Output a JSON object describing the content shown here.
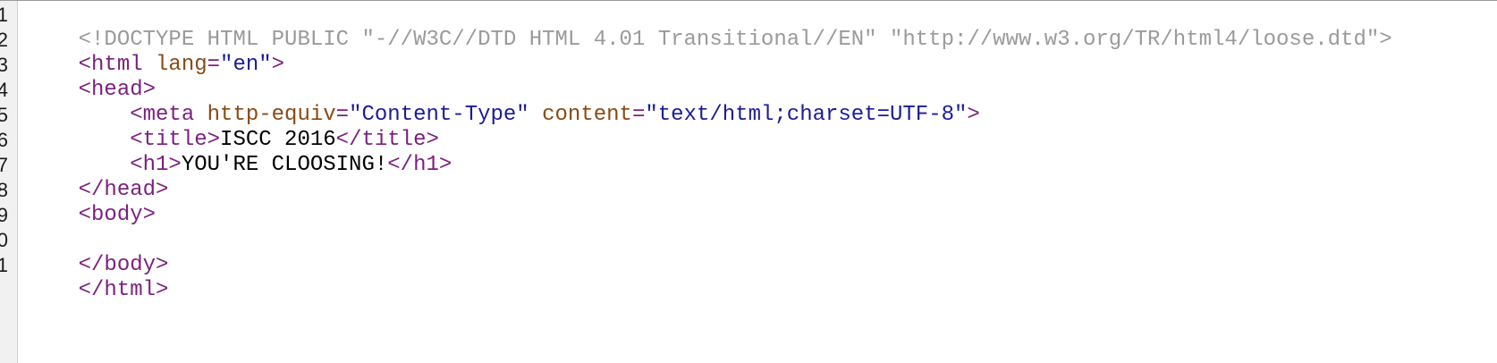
{
  "editor": {
    "line_numbers": [
      "1",
      "2",
      "3",
      "4",
      "5",
      "6",
      "7",
      "8",
      "9",
      "0",
      "1"
    ],
    "lines": {
      "line1_doctype": "<!DOCTYPE HTML PUBLIC \"-//W3C//DTD HTML 4.01 Transitional//EN\" \"http://www.w3.org/TR/html4/loose.dtd\">",
      "line2_tag_open": "<html",
      "line2_attr": "lang",
      "line2_eq": "=",
      "line2_value": "\"en\"",
      "line2_close": ">",
      "line3_tag": "<head>",
      "line4_indent": "    ",
      "line4_tag_open": "<meta",
      "line4_attr1": "http-equiv",
      "line4_eq1": "=",
      "line4_value1": "\"Content-Type\"",
      "line4_attr2": "content",
      "line4_eq2": "=",
      "line4_value2": "\"text/html;charset=UTF-8\"",
      "line4_close": ">",
      "line5_indent": "    ",
      "line5_tag_open": "<title>",
      "line5_text": "ISCC 2016",
      "line5_tag_close": "</title>",
      "line6_indent": "    ",
      "line6_tag_open": "<h1>",
      "line6_text": "YOU'RE CLOOSING!",
      "line6_tag_close": "</h1>",
      "line7_tag": "</head>",
      "line8_tag": "<body>",
      "line9_text": "",
      "line10_tag": "</body>",
      "line11_tag": "</html>"
    }
  }
}
